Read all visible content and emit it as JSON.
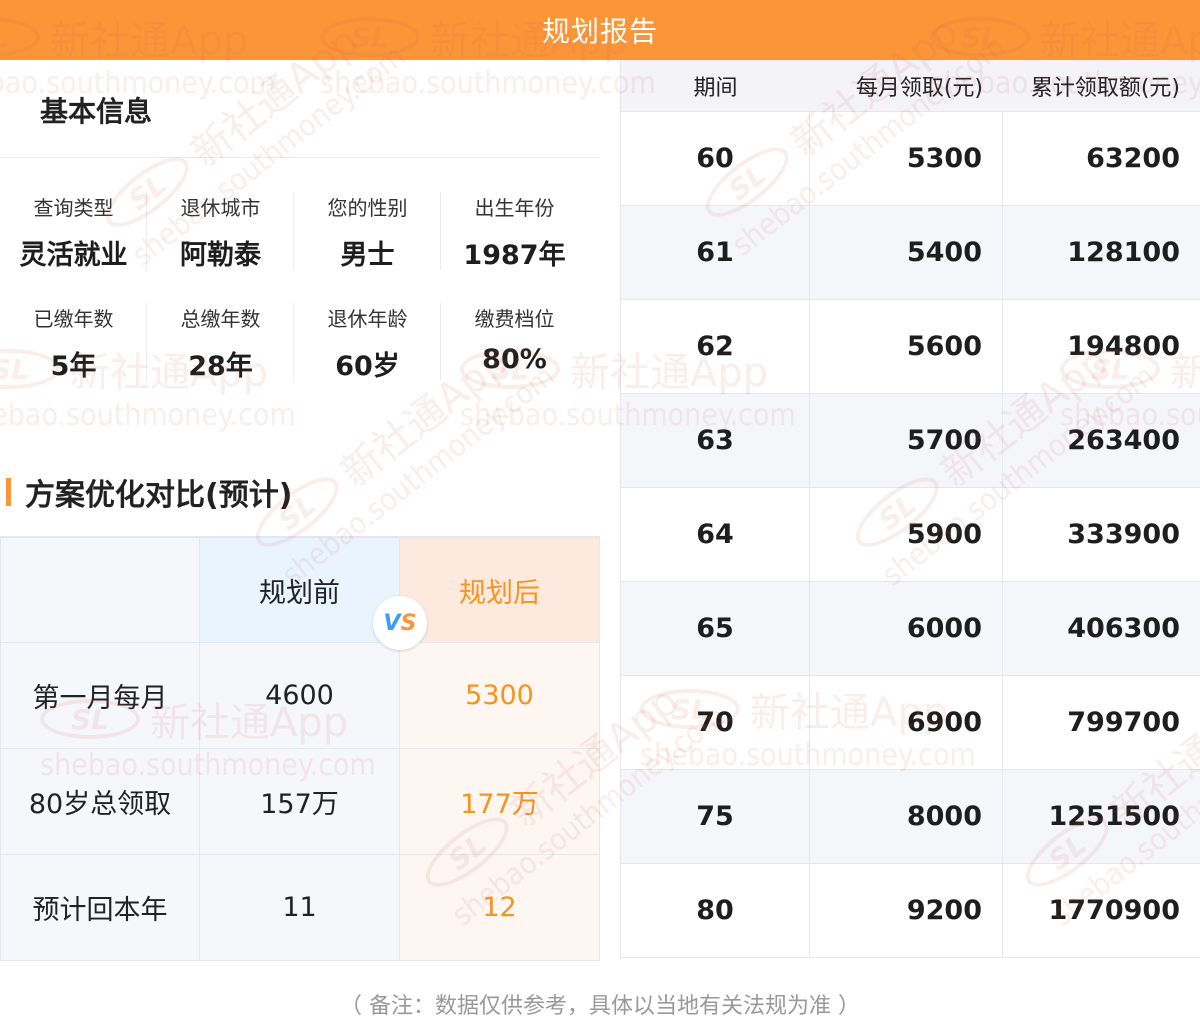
{
  "header": {
    "title": "规划报告"
  },
  "basic_info": {
    "title": "基本信息",
    "rows": [
      [
        {
          "label": "查询类型",
          "value": "灵活就业"
        },
        {
          "label": "退休城市",
          "value": "阿勒泰"
        },
        {
          "label": "您的性别",
          "value": "男士"
        },
        {
          "label": "出生年份",
          "value": "1987年"
        }
      ],
      [
        {
          "label": "已缴年数",
          "value": "5年"
        },
        {
          "label": "总缴年数",
          "value": "28年"
        },
        {
          "label": "退休年龄",
          "value": "60岁"
        },
        {
          "label": "缴费档位",
          "value": "80%"
        }
      ]
    ]
  },
  "comparison": {
    "title": "方案优化对比(预计)",
    "head_before": "规划前",
    "head_after": "规划后",
    "vs": "VS",
    "rows": [
      {
        "label": "第一月每月",
        "before": "4600",
        "after": "5300"
      },
      {
        "label": "80岁总领取",
        "before": "157万",
        "after": "177万"
      },
      {
        "label": "预计回本年",
        "before": "11",
        "after": "12"
      }
    ]
  },
  "table": {
    "headers": [
      "期间",
      "每月领取(元)",
      "累计领取额(元)"
    ],
    "rows": [
      [
        "60",
        "5300",
        "63200"
      ],
      [
        "61",
        "5400",
        "128100"
      ],
      [
        "62",
        "5600",
        "194800"
      ],
      [
        "63",
        "5700",
        "263400"
      ],
      [
        "64",
        "5900",
        "333900"
      ],
      [
        "65",
        "6000",
        "406300"
      ],
      [
        "70",
        "6900",
        "799700"
      ],
      [
        "75",
        "8000",
        "1251500"
      ],
      [
        "80",
        "9200",
        "1770900"
      ]
    ]
  },
  "footnote": "（ 备注：数据仅供参考，具体以当地有关法规为准 ）",
  "watermark": {
    "logo": "SL",
    "brand": "新社通App",
    "url": "shebao.southmoney.com"
  },
  "colors": {
    "accent": "#fb9638",
    "after_text": "#f7931e",
    "vs_blue": "#3f9cf2"
  }
}
